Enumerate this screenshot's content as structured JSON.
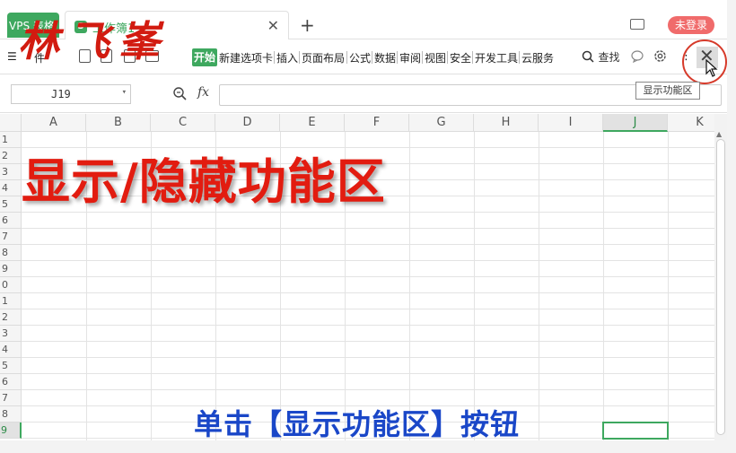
{
  "logo_text": "林飞峯",
  "tabs": {
    "wps_label": "VPS 表格",
    "book_icon": "S",
    "book_name": "工作簿1",
    "close": "✕",
    "add": "+",
    "login": "未登录"
  },
  "menu": {
    "hamburger": "☰",
    "file": "件",
    "start": "开始",
    "items": [
      "新建选项卡",
      "插入",
      "页面布局",
      "公式",
      "数据",
      "审阅",
      "视图",
      "安全",
      "开发工具",
      "云服务"
    ],
    "search": "查找",
    "more": "⋮",
    "close_ribbon": "✕",
    "tooltip": "显示功能区"
  },
  "formula_bar": {
    "cell_ref": "J19",
    "fx": "fx"
  },
  "grid": {
    "columns": [
      "A",
      "B",
      "C",
      "D",
      "E",
      "F",
      "G",
      "H",
      "I",
      "J",
      "K"
    ],
    "rows": [
      "1",
      "2",
      "3",
      "4",
      "5",
      "6",
      "7",
      "8",
      "9",
      "0",
      "1",
      "2",
      "3",
      "4",
      "5",
      "6",
      "7",
      "8",
      "9"
    ],
    "active_column": "J",
    "active_row_index": 18
  },
  "overlay": {
    "title": "显示/隐藏功能区",
    "caption": "单击【显示功能区】按钮"
  },
  "colors": {
    "accent": "#3ea85f",
    "title_red": "#e21c10",
    "caption_blue": "#1a47c8",
    "login_red": "#f06b6b"
  }
}
